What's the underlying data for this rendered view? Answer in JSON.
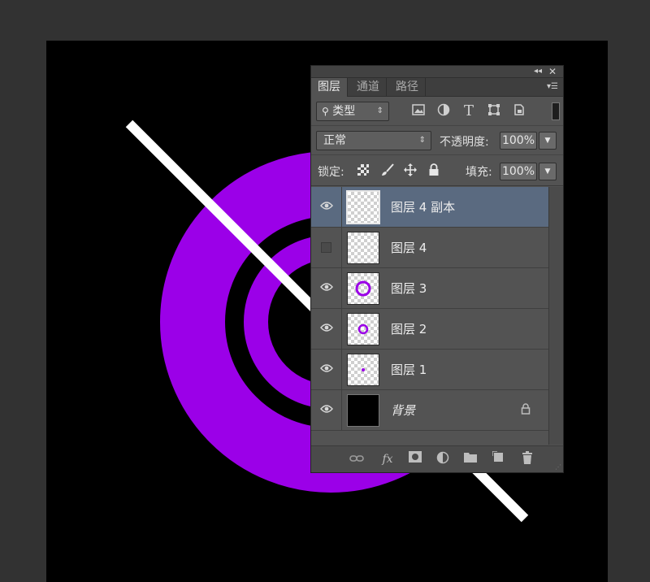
{
  "colors": {
    "workspace": "#323232",
    "document_bg": "#000000",
    "ring_color": "#9b00e8",
    "line_color": "#ffffff",
    "panel_bg": "#535353",
    "selected_layer": "#5a6a80"
  },
  "panel": {
    "titlebar_icons": [
      "collapse-icon",
      "close-icon"
    ],
    "tabs": [
      {
        "label": "图层",
        "active": true
      },
      {
        "label": "通道",
        "active": false
      },
      {
        "label": "路径",
        "active": false
      }
    ],
    "filter": {
      "kind_label": "类型",
      "icons": [
        "image-filter-icon",
        "adjustment-filter-icon",
        "type-filter-icon",
        "shape-filter-icon",
        "smart-object-filter-icon"
      ]
    },
    "blend_mode": "正常",
    "opacity_label": "不透明度:",
    "opacity_value": "100%",
    "lock_label": "锁定:",
    "lock_icons": [
      "lock-transparent-icon",
      "lock-image-icon",
      "lock-position-icon",
      "lock-all-icon"
    ],
    "fill_label": "填充:",
    "fill_value": "100%",
    "layers": [
      {
        "name": "图层 4 副本",
        "visible": true,
        "selected": true,
        "thumb": "empty"
      },
      {
        "name": "图层 4",
        "visible": false,
        "selected": false,
        "thumb": "empty"
      },
      {
        "name": "图层 3",
        "visible": true,
        "selected": false,
        "thumb": "ring-large"
      },
      {
        "name": "图层 2",
        "visible": true,
        "selected": false,
        "thumb": "ring-small"
      },
      {
        "name": "图层 1",
        "visible": true,
        "selected": false,
        "thumb": "dot"
      },
      {
        "name": "背景",
        "visible": true,
        "selected": false,
        "thumb": "black",
        "locked": true
      }
    ],
    "bottom_icons": [
      "link-layers-icon",
      "fx-icon",
      "add-mask-icon",
      "new-adjustment-icon",
      "new-group-icon",
      "new-layer-icon",
      "delete-layer-icon"
    ],
    "fx_label": "fx"
  }
}
